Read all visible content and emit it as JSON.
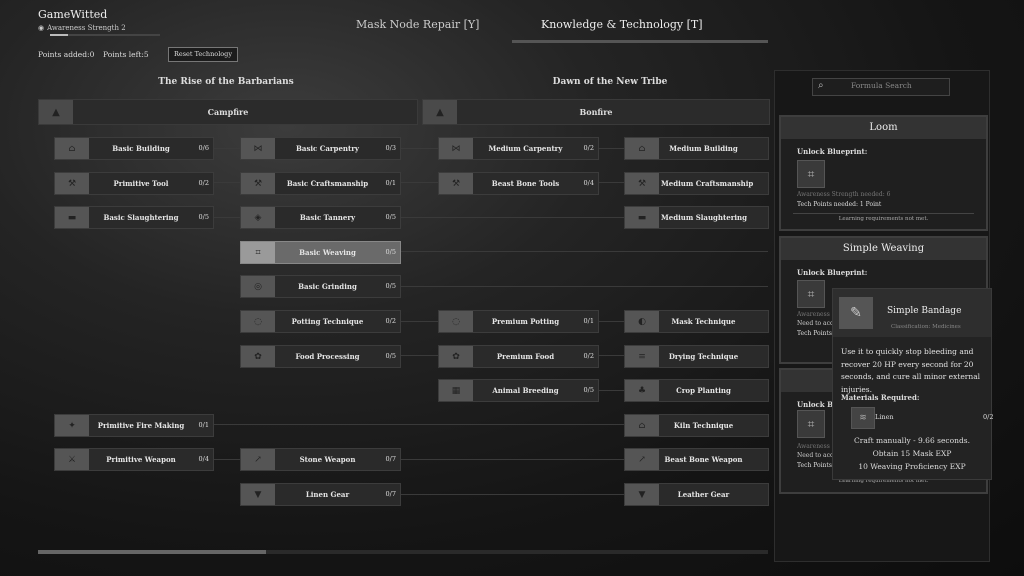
{
  "player": {
    "name": "GameWitted",
    "subtitle": "Awareness Strength 2",
    "progress": 0.16
  },
  "tabs": [
    {
      "label": "Mask Node Repair  [Y]",
      "active": false
    },
    {
      "label": "Knowledge & Technology  [T]",
      "active": true
    }
  ],
  "points": {
    "added": "Points added:0",
    "left": "Points left:5",
    "reset_label": "Reset Technology"
  },
  "eras": [
    {
      "title": "The Rise of the Barbarians",
      "bar_label": "Campfire",
      "bar_icon": "campfire-icon"
    },
    {
      "title": "Dawn of the New Tribe",
      "bar_label": "Bonfire",
      "bar_icon": "bonfire-icon"
    }
  ],
  "nodes": [
    {
      "label": "Basic Building",
      "count": "0/6",
      "icon": "building-icon",
      "col": 0,
      "row": 0
    },
    {
      "label": "Primitive Tool",
      "count": "0/2",
      "icon": "axe-icon",
      "col": 0,
      "row": 1
    },
    {
      "label": "Basic Slaughtering",
      "count": "0/5",
      "icon": "anvil-icon",
      "col": 0,
      "row": 2
    },
    {
      "label": "Primitive Fire Making",
      "count": "0/1",
      "icon": "fire-icon",
      "col": 0,
      "row": 8
    },
    {
      "label": "Primitive Weapon",
      "count": "0/4",
      "icon": "sword-icon",
      "col": 0,
      "row": 9
    },
    {
      "label": "Basic Carpentry",
      "count": "0/3",
      "icon": "saw-icon",
      "col": 1,
      "row": 0
    },
    {
      "label": "Basic Craftsmanship",
      "count": "0/1",
      "icon": "tools-icon",
      "col": 1,
      "row": 1
    },
    {
      "label": "Basic Tannery",
      "count": "0/5",
      "icon": "hide-icon",
      "col": 1,
      "row": 2
    },
    {
      "label": "Basic Weaving",
      "count": "0/5",
      "icon": "loom-icon",
      "col": 1,
      "row": 3,
      "selected": true
    },
    {
      "label": "Basic Grinding",
      "count": "0/5",
      "icon": "grinder-icon",
      "col": 1,
      "row": 4
    },
    {
      "label": "Potting Technique",
      "count": "0/2",
      "icon": "pot-icon",
      "col": 1,
      "row": 5
    },
    {
      "label": "Food Processing",
      "count": "0/5",
      "icon": "food-icon",
      "col": 1,
      "row": 6
    },
    {
      "label": "Stone Weapon",
      "count": "0/7",
      "icon": "spear-icon",
      "col": 1,
      "row": 9
    },
    {
      "label": "Linen Gear",
      "count": "0/7",
      "icon": "armor-icon",
      "col": 1,
      "row": 10
    },
    {
      "label": "Medium Carpentry",
      "count": "0/2",
      "icon": "saw-icon",
      "col": 2,
      "row": 0
    },
    {
      "label": "Beast Bone Tools",
      "count": "0/4",
      "icon": "bone-tool-icon",
      "col": 2,
      "row": 1
    },
    {
      "label": "Premium Potting",
      "count": "0/1",
      "icon": "pot-icon",
      "col": 2,
      "row": 5
    },
    {
      "label": "Premium Food",
      "count": "0/2",
      "icon": "food-icon",
      "col": 2,
      "row": 6
    },
    {
      "label": "Animal Breeding",
      "count": "0/5",
      "icon": "fence-icon",
      "col": 2,
      "row": 7
    },
    {
      "label": "Medium Building",
      "count": "",
      "icon": "building-icon",
      "col": 3,
      "row": 0
    },
    {
      "label": "Medium Craftsmanship",
      "count": "",
      "icon": "tools-icon",
      "col": 3,
      "row": 1
    },
    {
      "label": "Medium Slaughtering",
      "count": "",
      "icon": "anvil-icon",
      "col": 3,
      "row": 2
    },
    {
      "label": "Mask Technique",
      "count": "",
      "icon": "mask-icon",
      "col": 3,
      "row": 5
    },
    {
      "label": "Drying Technique",
      "count": "",
      "icon": "rack-icon",
      "col": 3,
      "row": 6
    },
    {
      "label": "Crop Planting",
      "count": "",
      "icon": "sprout-icon",
      "col": 3,
      "row": 7
    },
    {
      "label": "Kiln Technique",
      "count": "",
      "icon": "kiln-icon",
      "col": 3,
      "row": 8
    },
    {
      "label": "Beast Bone Weapon",
      "count": "",
      "icon": "bone-weapon-icon",
      "col": 3,
      "row": 9
    },
    {
      "label": "Leather Gear",
      "count": "",
      "icon": "armor-icon",
      "col": 3,
      "row": 10
    }
  ],
  "search": {
    "placeholder": "Formula Search"
  },
  "cards": [
    {
      "title": "Loom",
      "unlock_label": "Unlock Blueprint:",
      "icon": "loom-icon",
      "requirement": "Awareness Strength needed: 6",
      "tech_points": "Tech Points needed: 1 Point",
      "note": "Learning requirements not met."
    },
    {
      "title": "Simple Weaving",
      "unlock_label": "Unlock Blueprint:",
      "icon": "loom-icon",
      "requirement": "Awareness S",
      "requirement2": "Need to acqu",
      "tech_points": "Tech Points"
    },
    {
      "title": "",
      "unlock_label": "Unlock Bl",
      "icon": "bandage-icon",
      "requirement": "Awareness S",
      "requirement2": "Need to acqu",
      "tech_points": "Tech Points",
      "note": "Learning requirements not met."
    }
  ],
  "tooltip": {
    "name": "Simple Bandage",
    "category": "Classification: Medicines",
    "icon": "bandage-icon",
    "description": "Use it to quickly stop bleeding and recover 20 HP every second for 20 seconds, and cure all minor external injuries.",
    "materials_label": "Materials Required:",
    "material": {
      "name": "Linen",
      "count": "0/2",
      "icon": "linen-icon"
    },
    "craft": "Craft manually - 9.66 seconds.",
    "exp1": "Obtain 15 Mask EXP",
    "exp2": "10 Weaving Proficiency EXP"
  },
  "scrollbar": {
    "position": 0.0
  }
}
